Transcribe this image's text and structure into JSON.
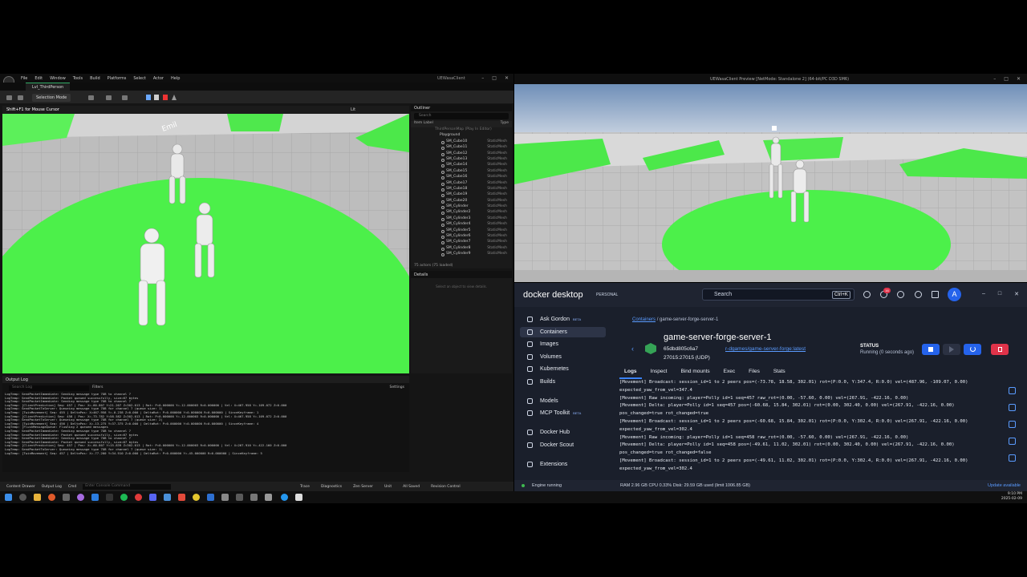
{
  "unreal": {
    "menu": [
      "File",
      "Edit",
      "Window",
      "Tools",
      "Build",
      "Platforms",
      "Select",
      "Actor",
      "Help"
    ],
    "window_title": "UEWasaClient",
    "level_tab": "Lvl_ThirdPerson",
    "selection_mode": "Selection Mode",
    "viewport_hint": "Shift+F1 for Mouse Cursor",
    "viewport_lit": "Lit",
    "overhead_label": "Emil",
    "outliner": {
      "title": "Outliner",
      "search_placeholder": "Search",
      "col_label": "Item Label",
      "col_type": "Type",
      "pie_row": "ThirdPersonMap (Play In Editor)",
      "folder": "Playground",
      "rows": [
        {
          "label": "SM_Cube10",
          "type": "StaticMesh"
        },
        {
          "label": "SM_Cube11",
          "type": "StaticMesh"
        },
        {
          "label": "SM_Cube12",
          "type": "StaticMesh"
        },
        {
          "label": "SM_Cube13",
          "type": "StaticMesh"
        },
        {
          "label": "SM_Cube14",
          "type": "StaticMesh"
        },
        {
          "label": "SM_Cube15",
          "type": "StaticMesh"
        },
        {
          "label": "SM_Cube16",
          "type": "StaticMesh"
        },
        {
          "label": "SM_Cube17",
          "type": "StaticMesh"
        },
        {
          "label": "SM_Cube18",
          "type": "StaticMesh"
        },
        {
          "label": "SM_Cube19",
          "type": "StaticMesh"
        },
        {
          "label": "SM_Cube20",
          "type": "StaticMesh"
        },
        {
          "label": "SM_Cylinder",
          "type": "StaticMesh"
        },
        {
          "label": "SM_Cylinder2",
          "type": "StaticMesh"
        },
        {
          "label": "SM_Cylinder3",
          "type": "StaticMesh"
        },
        {
          "label": "SM_Cylinder4",
          "type": "StaticMesh"
        },
        {
          "label": "SM_Cylinder5",
          "type": "StaticMesh"
        },
        {
          "label": "SM_Cylinder6",
          "type": "StaticMesh"
        },
        {
          "label": "SM_Cylinder7",
          "type": "StaticMesh"
        },
        {
          "label": "SM_Cylinder8",
          "type": "StaticMesh"
        },
        {
          "label": "SM_Cylinder9",
          "type": "StaticMesh"
        }
      ],
      "count": "75 actors (75 loaded)"
    },
    "details": {
      "title": "Details",
      "empty": "Select an object to view details."
    },
    "output_log": {
      "title": "Output Log",
      "search_placeholder": "Search Log",
      "filters": "Filters",
      "settings": "Settings",
      "lines": [
        "LogTemp: SendPacketImmediate: Sending message type 7OB to channel 7",
        "LogTemp: SendPacketImmediate: Packet queued successfully, size=67 bytes",
        "LogTemp: SendPacketImmediate: Sending message type 7OB to channel 7",
        "LogTemp: [ClientPrediction] Seq: 457 | Pos: X=-60.807 Y=21.207 Z=302.013 | Rot: P=0.000000 Y=-12.000003 R=0.000000 | Vel: X=467.958 Y=-109.072 Z=0.000",
        "LogTemp: SendPacketToServer: Queueing message type 7OB for channel 7 (queue size: 1)",
        "LogTemp: [TwinMovement] Seq: 455 | DeltaPos: X=467.958 Y=-0.238 Z=0.000 | DeltaRot: P=0.000000 Y=0.000000 R=0.000000 | SinceKeyframe: 1",
        "LogTemp: [ClientPrediction] Seq: 458 | Pos: X=-73.782 Y=58.582 Z=302.013 | Rot: P=0.000000 Y=-12.000003 R=0.000000 | Vel: X=467.958 Y=-109.072 Z=0.000",
        "LogTemp: SendPacketToServer: Queueing message type 7OB for channel 7 (queue size: 2)",
        "LogTemp: [TwinMovement] Seq: 456 | DeltaPos: X=-13.275 Y=37.375 Z=0.000 | DeltaRot: P=0.000000 Y=0.000000 R=0.000000 | SinceKeyframe: 4",
        "LogTemp: [FlushMessageQueue: Flushing 2 queued messages",
        "LogTemp: SendPacketImmediate: Sending message type 7OB to channel 7",
        "LogTemp: SendPacketImmediate: Packet queued successfully, size=67 bytes",
        "LogTemp: SendPacketImmediate: Sending message type 7OB to channel 7",
        "LogTemp: SendPacketImmediate: Packet queued successfully, size=67 bytes",
        "LogTemp: [ClientPrediction] Seq: 457 | Pos: X=-60.807 Y=15.839 Z=302.013 | Rot: P=0.000000 Y=-12.000003 R=0.000000 | Vel: X=267.910 Y=-422.160 Z=0.000",
        "LogTemp: SendPacketToServer: Queueing message type 7OB for channel 7 (queue size: 1)",
        "LogTemp: [TwinMovement] Seq: 457 | DeltaPos: X=-77.200 Y=34.910 Z=0.000 | DeltaRot: P=0.000000 Y=-45.000000 R=0.000000 | SinceKeyframe: 5"
      ]
    },
    "status": {
      "content_drawer": "Content Drawer",
      "output_log": "Output Log",
      "cmd": "Cmd",
      "cmd_placeholder": "Enter Console Command",
      "trace": "Trace",
      "diagnostics": "Diagnostics",
      "zen_server": "Zen Server",
      "unit": "Unit",
      "all_saved": "All Saved",
      "revision_control": "Revision Control"
    }
  },
  "game_preview": {
    "title": "UEWasaClient Preview [NetMode: Standalone 2] (64-bit/PC D3D SM6)"
  },
  "docker": {
    "brand": "docker desktop",
    "plan": "PERSONAL",
    "search_placeholder": "Search",
    "search_shortcut": "Ctrl+K",
    "notification_count": "16",
    "avatar": "A",
    "sidebar": [
      {
        "label": "Ask Gordon",
        "beta": "BETA"
      },
      {
        "label": "Containers",
        "beta": ""
      },
      {
        "label": "Images",
        "beta": ""
      },
      {
        "label": "Volumes",
        "beta": ""
      },
      {
        "label": "Kubernetes",
        "beta": ""
      },
      {
        "label": "Builds",
        "beta": ""
      },
      {
        "label": "Models",
        "beta": ""
      },
      {
        "label": "MCP Toolkit",
        "beta": "BETA"
      },
      {
        "label": "Docker Hub",
        "beta": ""
      },
      {
        "label": "Docker Scout",
        "beta": ""
      },
      {
        "label": "Extensions",
        "beta": ""
      }
    ],
    "breadcrumb_link": "Containers",
    "breadcrumb_current": "game-server-forge-server-1",
    "container": {
      "name": "game-server-forge-server-1",
      "id": "65dbd805c6a7",
      "image": "r-dgames/game-server-forge:latest",
      "ports": "27015:27015 (UDP)",
      "status_label": "STATUS",
      "status_value": "Running (0 seconds ago)"
    },
    "tabs": [
      "Logs",
      "Inspect",
      "Bind mounts",
      "Exec",
      "Files",
      "Stats"
    ],
    "logs": [
      "[Movement] Broadcast: session_id=1 to 2 peers pos=(-73.78, 18.58, 302.01) rot=(P:0.0, Y:347.4, R:0.0) vel=(487.96, -109.07, 0.00)",
      "expected_yaw_from_vel=347.4",
      "[Movement] Raw incoming: player=Polly id=1 seq=457 raw_rot=(0.00, -57.60, 0.00) vel=(267.91, -422.16, 0.00)",
      "[Movement] Delta: player=Polly id=1 seq=457 pos=(-60.68, 15.84, 302.01) rot=(0.00, 302.40, 0.00) vel=(267.91, -422.16, 0.00)",
      "pos_changed=true rot_changed=true",
      "[Movement] Broadcast: session_id=1 to 2 peers pos=(-60.68, 15.84, 302.01) rot=(P:0.0, Y:302.4, R:0.0) vel=(267.91, -422.16, 0.00)",
      "expected_yaw_from_vel=302.4",
      "[Movement] Raw incoming: player=Polly id=1 seq=458 raw_rot=(0.00, -57.60, 0.00) vel=(267.91, -422.16, 0.00)",
      "[Movement] Delta: player=Polly id=1 seq=458 pos=(-49.61, 11.02, 302.01) rot=(0.00, 302.40, 0.00) vel=(267.91, -422.16, 0.00)",
      "pos_changed=true rot_changed=false",
      "[Movement] Broadcast: session_id=1 to 2 peers pos=(-49.61, 11.02, 302.01) rot=(P:0.0, Y:302.4, R:0.0) vel=(267.91, -422.16, 0.00)",
      "expected_yaw_from_vel=302.4"
    ],
    "status_bar": {
      "engine": "Engine running",
      "resources": "RAM 2.96 GB   CPU 0.33%      Disk: 29.59 GB used (limit 1006.85 GB)",
      "update": "Update available"
    }
  },
  "taskbar": {
    "time": "9:10 PM",
    "date": "2025-02-09"
  },
  "colors": {
    "ground_green": "#4cf04a",
    "docker_bg": "#1a1f2b",
    "docker_accent": "#3b82f6",
    "stop_button": "#2563eb",
    "delete_button": "#e0334a"
  }
}
